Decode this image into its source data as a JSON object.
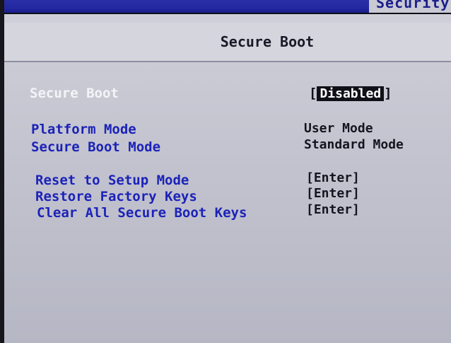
{
  "header": {
    "active_tab": "Security"
  },
  "page": {
    "title": "Secure Boot"
  },
  "settings": {
    "secure_boot": {
      "label": "Secure Boot",
      "value": "Disabled"
    },
    "platform_mode": {
      "label": "Platform Mode",
      "value": "User Mode"
    },
    "secure_boot_mode": {
      "label": "Secure Boot Mode",
      "value": "Standard Mode"
    },
    "reset_setup_mode": {
      "label": "Reset to Setup Mode",
      "value": "[Enter]"
    },
    "restore_factory_keys": {
      "label": "Restore Factory Keys",
      "value": "[Enter]"
    },
    "clear_all_keys": {
      "label": "Clear All Secure Boot Keys",
      "value": "[Enter]"
    }
  },
  "colors": {
    "tabbar": "#2226a0",
    "panel": "#c3c4cf",
    "label": "#1c22b8",
    "selected_label": "#f4f4f8",
    "value": "#15151f"
  }
}
